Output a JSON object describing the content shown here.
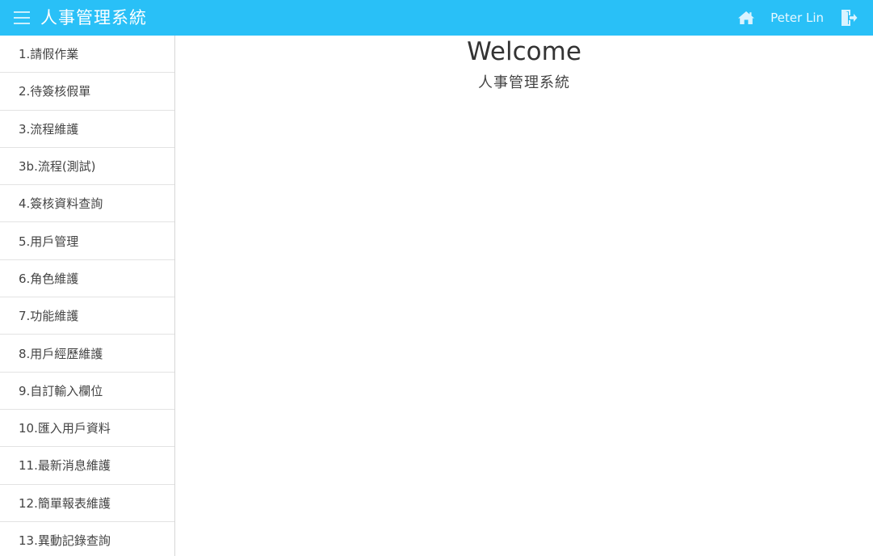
{
  "header": {
    "title": "人事管理系統",
    "user_name": "Peter Lin",
    "menu_icon": "hamburger-menu-icon",
    "home_icon": "home-icon",
    "logout_icon": "logout-icon",
    "bar_color": "#29c0f7"
  },
  "sidebar": {
    "items": [
      {
        "label": "1.請假作業"
      },
      {
        "label": "2.待簽核假單"
      },
      {
        "label": "3.流程維護"
      },
      {
        "label": "3b.流程(測試)"
      },
      {
        "label": "4.簽核資料查詢"
      },
      {
        "label": "5.用戶管理"
      },
      {
        "label": "6.角色維護"
      },
      {
        "label": "7.功能維護"
      },
      {
        "label": "8.用戶經歷維護"
      },
      {
        "label": "9.自訂輸入欄位"
      },
      {
        "label": "10.匯入用戶資料"
      },
      {
        "label": "11.最新消息維護"
      },
      {
        "label": "12.簡單報表維護"
      },
      {
        "label": "13.異動記錄查詢"
      }
    ]
  },
  "main": {
    "heading": "Welcome",
    "subheading": "人事管理系統"
  }
}
